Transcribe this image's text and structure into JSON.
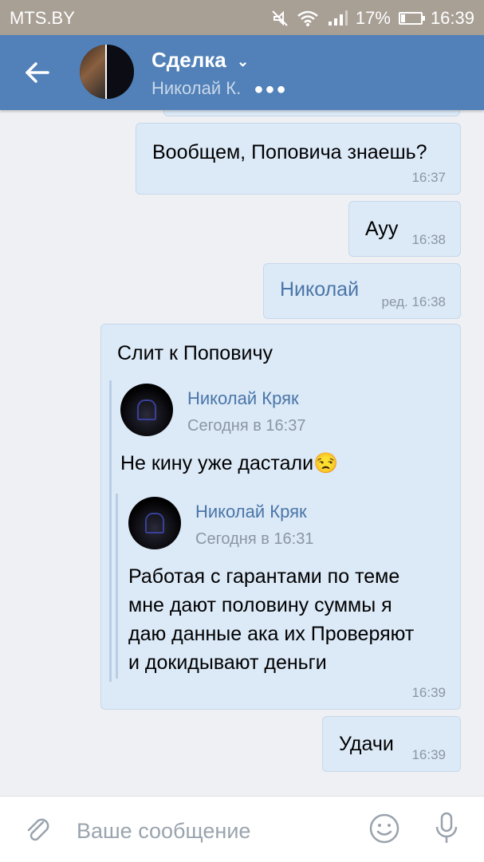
{
  "status_bar": {
    "carrier": "MTS.BY",
    "battery": "17%",
    "time": "16:39"
  },
  "header": {
    "title": "Сделка",
    "subtitle": "Николай К."
  },
  "messages": [
    {
      "text": "Вообщем, Поповича знаешь?",
      "time": "16:37"
    },
    {
      "text": "Ауу",
      "time": "16:38"
    },
    {
      "text": "Николай",
      "time": "ред. 16:38"
    },
    {
      "text": "Слит к Поповичу",
      "time": "16:39",
      "forward": {
        "name": "Николай Кряк",
        "date": "Сегодня в 16:37",
        "text": "Не кину уже дастали",
        "emoji": "😒",
        "forward": {
          "name": "Николай Кряк",
          "date": "Сегодня в 16:31",
          "lines": [
            "Работая с гарантами по теме",
            "мне дают половину суммы я",
            "даю данные ака их Проверяют",
            "и докидывают деньги"
          ]
        }
      }
    },
    {
      "text": "Удачи",
      "time": "16:39"
    }
  ],
  "composer": {
    "placeholder": "Ваше сообщение"
  },
  "colors": {
    "header_bg": "#5181b8",
    "bubble_bg": "#dce9f7",
    "link": "#4a76a8"
  }
}
